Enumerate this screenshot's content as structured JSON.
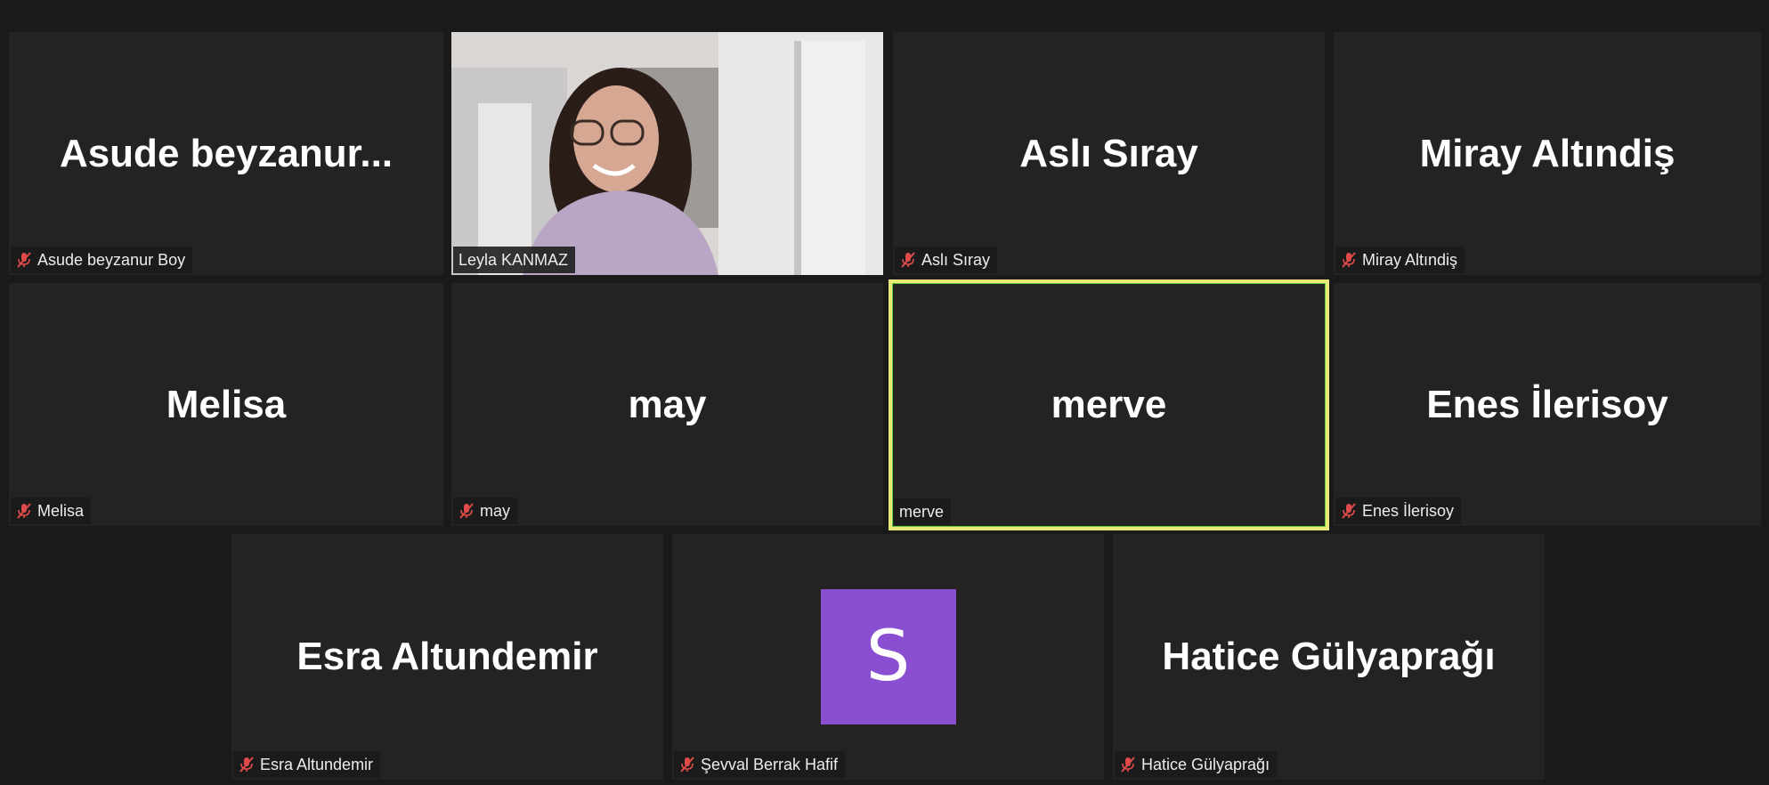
{
  "colors": {
    "background": "#1a1a1a",
    "tile": "#232323",
    "active_border": "#e9e97a",
    "avatar_purple": "#8a4fd0",
    "mute_red": "#e04a4a"
  },
  "participants": [
    {
      "tile_name": "Asude  beyzanur...",
      "label": "Asude beyzanur Boy",
      "muted": true,
      "video": false
    },
    {
      "tile_name": "",
      "label": "Leyla KANMAZ",
      "muted": false,
      "video": true
    },
    {
      "tile_name": "Aslı Sıray",
      "label": "Aslı Sıray",
      "muted": true,
      "video": false
    },
    {
      "tile_name": "Miray Altındiş",
      "label": "Miray Altındiş",
      "muted": true,
      "video": false
    },
    {
      "tile_name": "Melisa",
      "label": "Melisa",
      "muted": true,
      "video": false
    },
    {
      "tile_name": "may",
      "label": "may",
      "muted": true,
      "video": false
    },
    {
      "tile_name": "merve",
      "label": "merve",
      "muted": false,
      "video": false,
      "active_speaker": true
    },
    {
      "tile_name": "Enes İlerisoy",
      "label": "Enes İlerisoy",
      "muted": true,
      "video": false
    },
    {
      "tile_name": "Esra Altundemir",
      "label": "Esra Altundemir",
      "muted": true,
      "video": false
    },
    {
      "avatar_letter": "S",
      "label": "Şevval Berrak Hafif",
      "muted": true,
      "video": false
    },
    {
      "tile_name": "Hatice Gülyaprağı",
      "label": "Hatice Gülyaprağı",
      "muted": true,
      "video": false
    }
  ],
  "icons": {
    "muted_mic": "mic-muted-icon"
  }
}
